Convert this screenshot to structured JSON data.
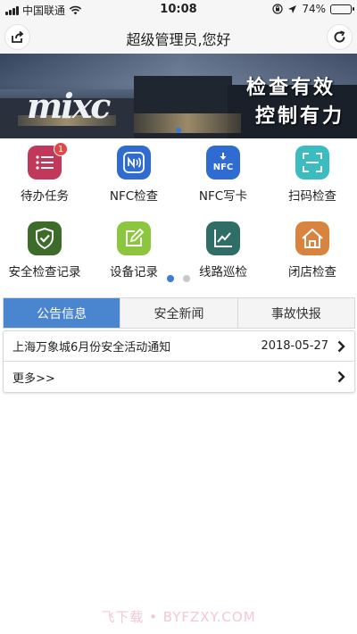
{
  "status_bar": {
    "carrier": "中国联通",
    "time": "10:08",
    "battery": "74%",
    "battery_level": 0.74
  },
  "nav": {
    "title": "超级管理员,您好",
    "left_icon": "share-icon",
    "right_icon": "refresh-icon"
  },
  "banner": {
    "brand": "mixc",
    "slogan_line1": "检查有效",
    "slogan_line2": "控制有力"
  },
  "grid": {
    "items": [
      {
        "label": "待办任务",
        "icon": "list-icon",
        "color": "#c2385b",
        "badge": "1"
      },
      {
        "label": "NFC检查",
        "icon": "nfc-icon",
        "color": "#2f6bd0"
      },
      {
        "label": "NFC写卡",
        "icon": "nfc-download-icon",
        "color": "#2f6bd0",
        "icon_text": "NFC"
      },
      {
        "label": "扫码检查",
        "icon": "scan-icon",
        "color": "#3cbcc0"
      },
      {
        "label": "安全检查记录",
        "icon": "shield-check-icon",
        "color": "#3d6b2a"
      },
      {
        "label": "设备记录",
        "icon": "edit-icon",
        "color": "#8cc63f"
      },
      {
        "label": "线路巡检",
        "icon": "line-chart-icon",
        "color": "#2f6e66"
      },
      {
        "label": "闭店检查",
        "icon": "home-icon",
        "color": "#d9843e"
      }
    ]
  },
  "tabs": [
    {
      "label": "公告信息",
      "active": true
    },
    {
      "label": "安全新闻",
      "active": false
    },
    {
      "label": "事故快报",
      "active": false
    }
  ],
  "news": {
    "items": [
      {
        "title": "上海万象城6月份安全活动通知",
        "date": "2018-05-27"
      }
    ],
    "more_label": "更多>>"
  },
  "watermark": "飞下载 • BYFZXY.COM"
}
